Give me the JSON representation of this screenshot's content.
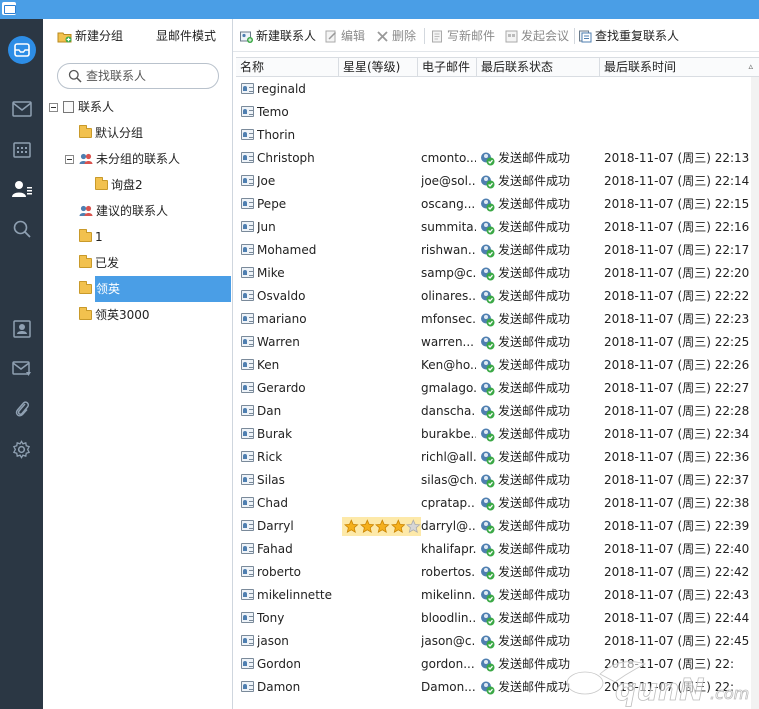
{
  "groups_toolbar": {
    "new_group": "新建分组",
    "mail_mode": "显邮件模式"
  },
  "search": {
    "placeholder": "查找联系人"
  },
  "tree": [
    {
      "label": "联系人",
      "type": "root"
    },
    {
      "label": "默认分组",
      "type": "folder"
    },
    {
      "label": "未分组的联系人",
      "type": "people"
    },
    {
      "label": "询盘2",
      "type": "folder"
    },
    {
      "label": "建议的联系人",
      "type": "people"
    },
    {
      "label": "1",
      "type": "folder"
    },
    {
      "label": "已发",
      "type": "folder"
    },
    {
      "label": "领英",
      "type": "folder",
      "selected": true
    },
    {
      "label": "领英3000",
      "type": "folder"
    }
  ],
  "toolbar": {
    "new_contact": "新建联系人",
    "edit": "编辑",
    "delete": "删除",
    "write_mail": "写新邮件",
    "start_meeting": "发起会议",
    "find_duplicates": "查找重复联系人"
  },
  "columns": {
    "name": "名称",
    "stars": "星星(等级)",
    "email": "电子邮件",
    "last_status": "最后联系状态",
    "last_time": "最后联系时间",
    "sort_indicator": "▵"
  },
  "contacts": [
    {
      "name": "reginald",
      "email": "",
      "status": "",
      "time": ""
    },
    {
      "name": "Temo",
      "email": "",
      "status": "",
      "time": ""
    },
    {
      "name": "Thorin",
      "email": "",
      "status": "",
      "time": ""
    },
    {
      "name": "Christoph",
      "email": "cmonto...",
      "status": "发送邮件成功",
      "time": "2018-11-07 (周三) 22:13"
    },
    {
      "name": "Joe",
      "email": "joe@sol...",
      "status": "发送邮件成功",
      "time": "2018-11-07 (周三) 22:14"
    },
    {
      "name": "Pepe",
      "email": "oscang...",
      "status": "发送邮件成功",
      "time": "2018-11-07 (周三) 22:15"
    },
    {
      "name": "Jun",
      "email": "summita...",
      "status": "发送邮件成功",
      "time": "2018-11-07 (周三) 22:16"
    },
    {
      "name": "Mohamed",
      "email": "rishwan...",
      "status": "发送邮件成功",
      "time": "2018-11-07 (周三) 22:17"
    },
    {
      "name": "Mike",
      "email": "samp@c...",
      "status": "发送邮件成功",
      "time": "2018-11-07 (周三) 22:20"
    },
    {
      "name": "Osvaldo",
      "email": "olinares...",
      "status": "发送邮件成功",
      "time": "2018-11-07 (周三) 22:22"
    },
    {
      "name": "mariano",
      "email": "mfonsec...",
      "status": "发送邮件成功",
      "time": "2018-11-07 (周三) 22:23"
    },
    {
      "name": "Warren",
      "email": "warren...",
      "status": "发送邮件成功",
      "time": "2018-11-07 (周三) 22:25"
    },
    {
      "name": "Ken",
      "email": "Ken@ho...",
      "status": "发送邮件成功",
      "time": "2018-11-07 (周三) 22:26"
    },
    {
      "name": "Gerardo",
      "email": "gmalago...",
      "status": "发送邮件成功",
      "time": "2018-11-07 (周三) 22:27"
    },
    {
      "name": "Dan",
      "email": "danscha...",
      "status": "发送邮件成功",
      "time": "2018-11-07 (周三) 22:28"
    },
    {
      "name": "Burak",
      "email": "burakbe...",
      "status": "发送邮件成功",
      "time": "2018-11-07 (周三) 22:34"
    },
    {
      "name": "Rick",
      "email": "richl@all...",
      "status": "发送邮件成功",
      "time": "2018-11-07 (周三) 22:36"
    },
    {
      "name": "Silas",
      "email": "silas@ch...",
      "status": "发送邮件成功",
      "time": "2018-11-07 (周三) 22:37"
    },
    {
      "name": "Chad",
      "email": "cpratap...",
      "status": "发送邮件成功",
      "time": "2018-11-07 (周三) 22:38"
    },
    {
      "name": "Darryl",
      "email": "darryl@...",
      "status": "发送邮件成功",
      "time": "2018-11-07 (周三) 22:39",
      "stars": 4,
      "stars_max": 5
    },
    {
      "name": "Fahad",
      "email": "khalifapr...",
      "status": "发送邮件成功",
      "time": "2018-11-07 (周三) 22:40"
    },
    {
      "name": "roberto",
      "email": "robertos...",
      "status": "发送邮件成功",
      "time": "2018-11-07 (周三) 22:42"
    },
    {
      "name": "mikelinnette",
      "email": "mikelinn...",
      "status": "发送邮件成功",
      "time": "2018-11-07 (周三) 22:43"
    },
    {
      "name": "Tony",
      "email": "bloodlin...",
      "status": "发送邮件成功",
      "time": "2018-11-07 (周三) 22:44"
    },
    {
      "name": "jason",
      "email": "jason@c...",
      "status": "发送邮件成功",
      "time": "2018-11-07 (周三) 22:45"
    },
    {
      "name": "Gordon",
      "email": "gordon...",
      "status": "发送邮件成功",
      "time": "2018-11-07 (周三) 22:"
    },
    {
      "name": "Damon",
      "email": "Damon...",
      "status": "发送邮件成功",
      "time": "2018-11-07 (周三) 22:"
    }
  ],
  "colors": {
    "titlebar": "#4a9ee6",
    "nav_bg": "#2b3744",
    "nav_active": "#2d8de6",
    "selection": "#4a9ee6",
    "star_highlight": "#fde9a9"
  },
  "icons": {
    "nav": [
      "mail-home-icon",
      "inbox-icon",
      "calendar-icon",
      "contacts-icon",
      "search-icon",
      "address-card-icon",
      "mail-filter-icon",
      "attachment-icon",
      "settings-icon"
    ],
    "status": "sent-success-icon",
    "row": "contact-card-icon"
  }
}
